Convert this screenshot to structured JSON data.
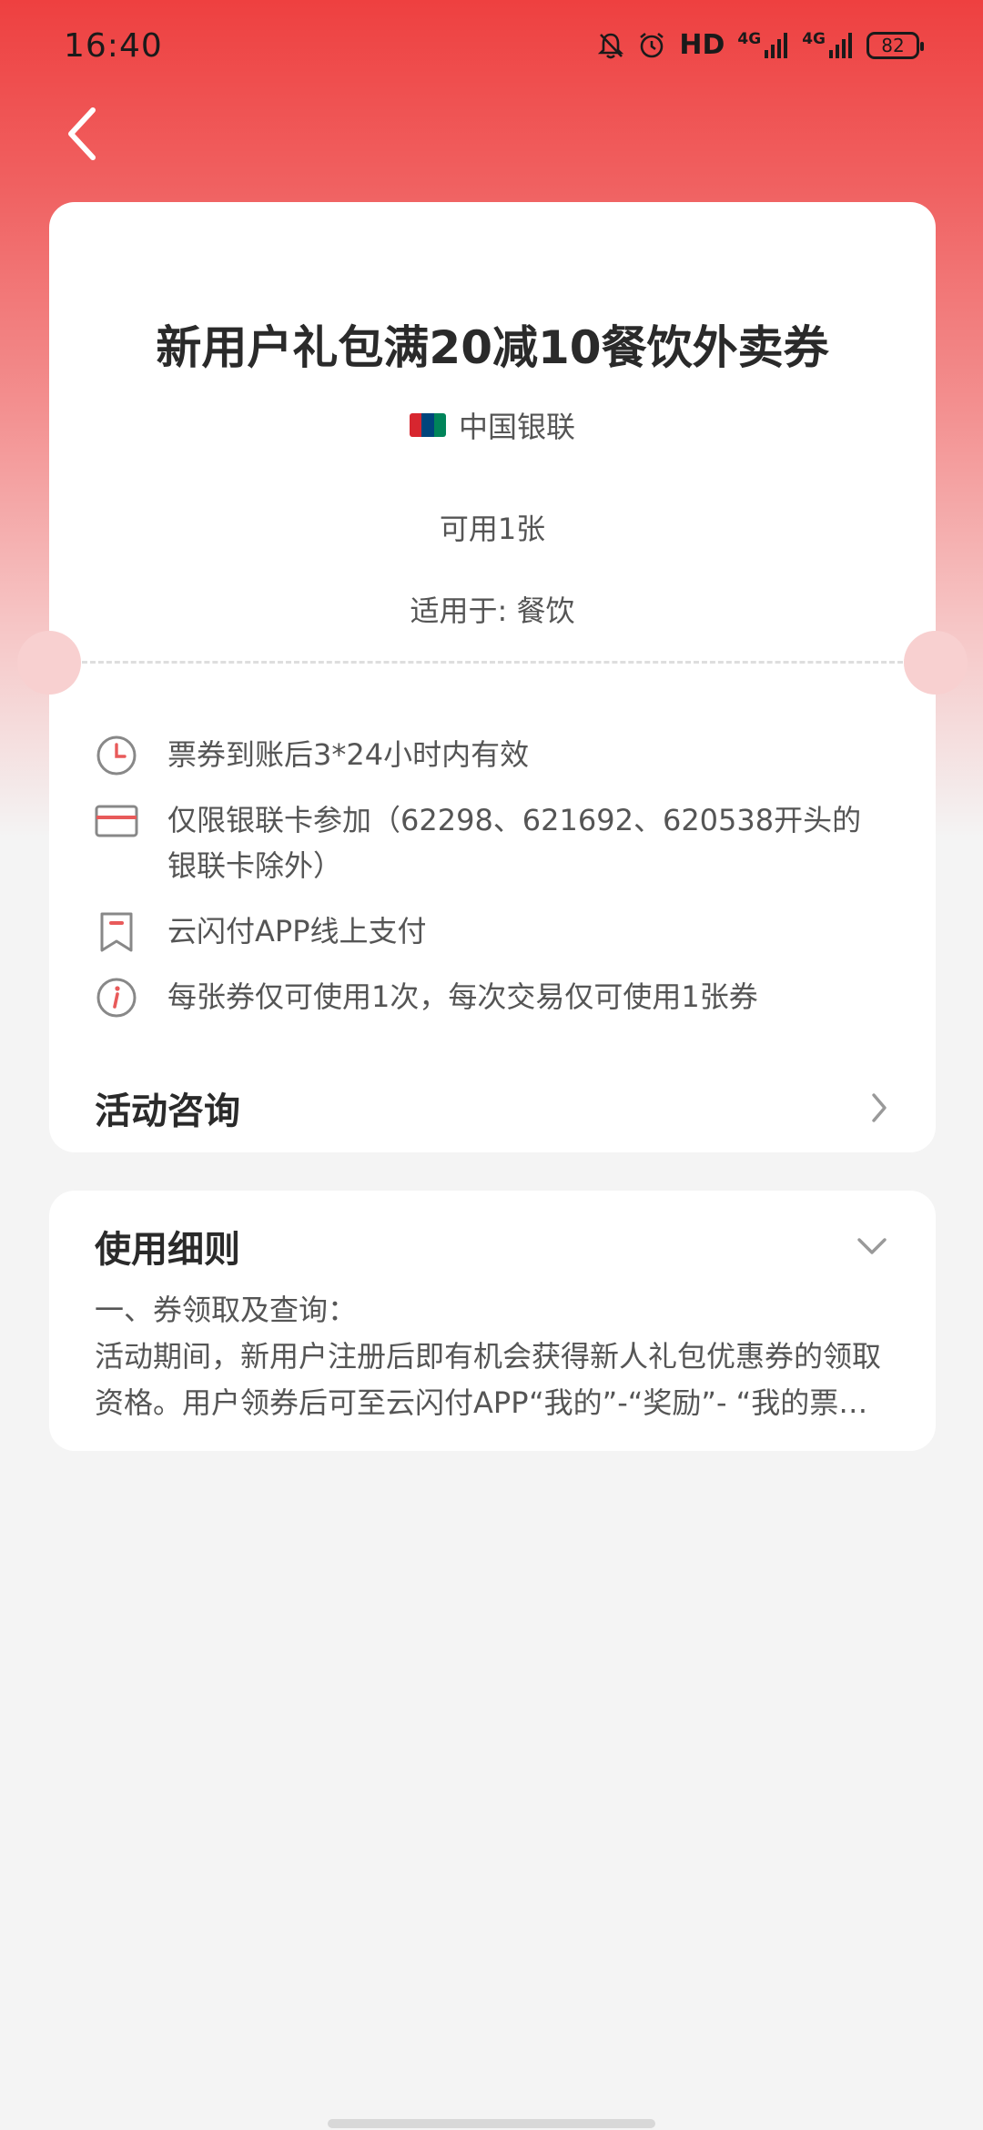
{
  "status_bar": {
    "time": "16:40",
    "hd_label": "HD",
    "net_label_1": "4G",
    "net_label_2": "4G",
    "battery": "82",
    "icons": [
      "mute-bell-icon",
      "alarm-icon",
      "signal-icon",
      "signal-icon"
    ]
  },
  "nav": {
    "back_icon": "chevron-left-icon"
  },
  "coupon": {
    "title": "新用户礼包满20减10餐饮外卖券",
    "issuer": "中国银联",
    "available": "可用1张",
    "applies_to": "适用于: 餐饮",
    "rules": [
      {
        "icon": "clock-icon",
        "text": "票券到账后3*24小时内有效"
      },
      {
        "icon": "card-icon",
        "text": "仅限银联卡参加（62298、621692、620538开头的银联卡除外）"
      },
      {
        "icon": "bookmark-icon",
        "text": "云闪付APP线上支付"
      },
      {
        "icon": "info-icon",
        "text": "每张券仅可使用1次，每次交易仅可使用1张券"
      }
    ],
    "inquiry_label": "活动咨询"
  },
  "usage_rules": {
    "title": "使用细则",
    "heading": "一、券领取及查询：",
    "paragraph": "活动期间，新用户注册后即有机会获得新人礼包优惠券的领取资格。用户领券后可至云闪付APP“我的”-“奖励”- “我的票券”查询。"
  },
  "colors": {
    "brand_red": "#ee4040",
    "icon_gray": "#888888",
    "icon_red": "#e85a5a"
  }
}
